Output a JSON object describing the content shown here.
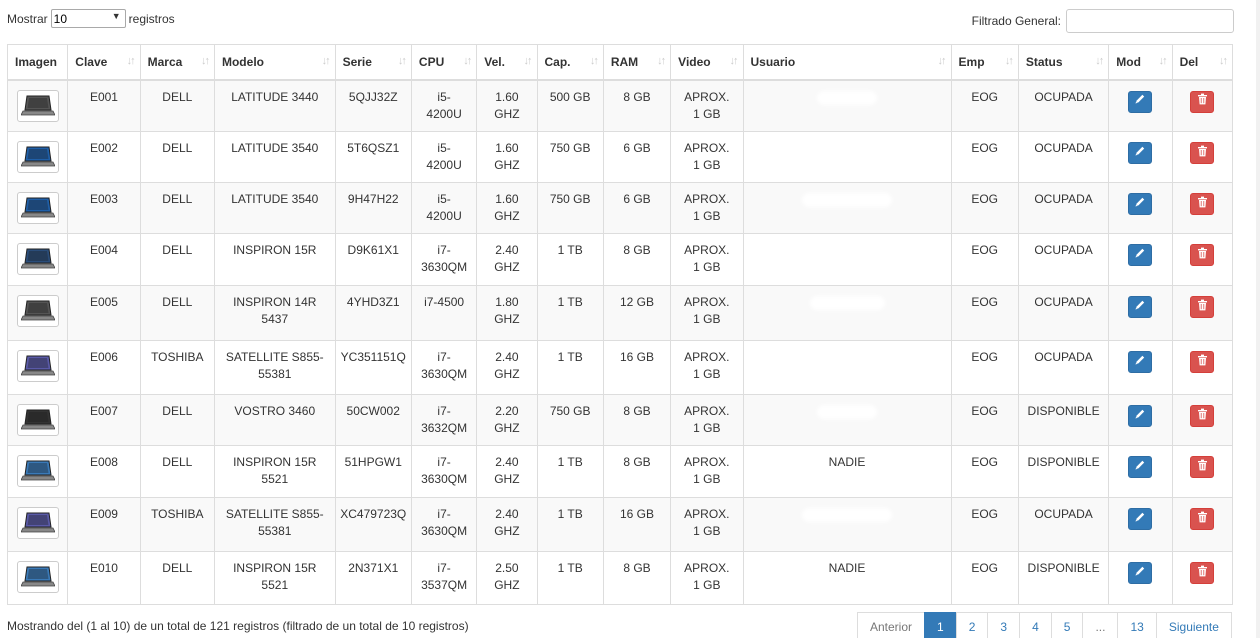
{
  "length_menu": {
    "prefix": "Mostrar",
    "value": "10",
    "suffix": "registros"
  },
  "filter": {
    "label": "Filtrado General:",
    "value": ""
  },
  "columns": [
    "Imagen",
    "Clave",
    "Marca",
    "Modelo",
    "Serie",
    "CPU",
    "Vel.",
    "Cap.",
    "RAM",
    "Video",
    "Usuario",
    "Emp",
    "Status",
    "Mod",
    "Del"
  ],
  "rows": [
    {
      "clave": "E001",
      "marca": "DELL",
      "modelo": "LATITUDE 3440",
      "serie": "5QJJ32Z",
      "cpu": "i5-\n4200U",
      "vel": "1.60\nGHZ",
      "cap": "500 GB",
      "ram": "8 GB",
      "video": "APROX.\n1 GB",
      "usuario": "",
      "emp": "EOG",
      "status": "OCUPADA",
      "laptop_color": "#555555"
    },
    {
      "clave": "E002",
      "marca": "DELL",
      "modelo": "LATITUDE 3540",
      "serie": "5T6QSZ1",
      "cpu": "i5-\n4200U",
      "vel": "1.60\nGHZ",
      "cap": "750 GB",
      "ram": "6 GB",
      "video": "APROX.\n1 GB",
      "usuario": "",
      "emp": "EOG",
      "status": "OCUPADA",
      "laptop_color": "#1f5fa8"
    },
    {
      "clave": "E003",
      "marca": "DELL",
      "modelo": "LATITUDE 3540",
      "serie": "9H47H22",
      "cpu": "i5-\n4200U",
      "vel": "1.60\nGHZ",
      "cap": "750 GB",
      "ram": "6 GB",
      "video": "APROX.\n1 GB",
      "usuario": "",
      "emp": "EOG",
      "status": "OCUPADA",
      "laptop_color": "#1f5fa8"
    },
    {
      "clave": "E004",
      "marca": "DELL",
      "modelo": "INSPIRON 15R",
      "serie": "D9K61X1",
      "cpu": "i7-\n3630QM",
      "vel": "2.40\nGHZ",
      "cap": "1 TB",
      "ram": "8 GB",
      "video": "APROX.\n1 GB",
      "usuario": "",
      "emp": "EOG",
      "status": "OCUPADA",
      "laptop_color": "#2a4d7a"
    },
    {
      "clave": "E005",
      "marca": "DELL",
      "modelo": "INSPIRON 14R\n5437",
      "serie": "4YHD3Z1",
      "cpu": "i7-4500",
      "vel": "1.80\nGHZ",
      "cap": "1 TB",
      "ram": "12 GB",
      "video": "APROX.\n1 GB",
      "usuario": "",
      "emp": "EOG",
      "status": "OCUPADA",
      "laptop_color": "#555555"
    },
    {
      "clave": "E006",
      "marca": "TOSHIBA",
      "modelo": "SATELLITE S855-\n55381",
      "serie": "YC351151Q",
      "cpu": "i7-\n3630QM",
      "vel": "2.40\nGHZ",
      "cap": "1 TB",
      "ram": "16 GB",
      "video": "APROX.\n1 GB",
      "usuario": "",
      "emp": "EOG",
      "status": "OCUPADA",
      "laptop_color": "#5a5aa8"
    },
    {
      "clave": "E007",
      "marca": "DELL",
      "modelo": "VOSTRO 3460",
      "serie": "50CW002",
      "cpu": "i7-\n3632QM",
      "vel": "2.20\nGHZ",
      "cap": "750 GB",
      "ram": "8 GB",
      "video": "APROX.\n1 GB",
      "usuario": "",
      "emp": "EOG",
      "status": "DISPONIBLE",
      "laptop_color": "#333333"
    },
    {
      "clave": "E008",
      "marca": "DELL",
      "modelo": "INSPIRON 15R\n5521",
      "serie": "51HPGW1",
      "cpu": "i7-\n3630QM",
      "vel": "2.40\nGHZ",
      "cap": "1 TB",
      "ram": "8 GB",
      "video": "APROX.\n1 GB",
      "usuario": "NADIE",
      "emp": "EOG",
      "status": "DISPONIBLE",
      "laptop_color": "#3a7ab8"
    },
    {
      "clave": "E009",
      "marca": "TOSHIBA",
      "modelo": "SATELLITE S855-\n55381",
      "serie": "XC479723Q",
      "cpu": "i7-\n3630QM",
      "vel": "2.40\nGHZ",
      "cap": "1 TB",
      "ram": "16 GB",
      "video": "APROX.\n1 GB",
      "usuario": "",
      "emp": "EOG",
      "status": "OCUPADA",
      "laptop_color": "#5a5aa8"
    },
    {
      "clave": "E010",
      "marca": "DELL",
      "modelo": "INSPIRON 15R\n5521",
      "serie": "2N371X1",
      "cpu": "i7-\n3537QM",
      "vel": "2.50\nGHZ",
      "cap": "1 TB",
      "ram": "8 GB",
      "video": "APROX.\n1 GB",
      "usuario": "NADIE",
      "emp": "EOG",
      "status": "DISPONIBLE",
      "laptop_color": "#3a7ab8"
    }
  ],
  "info_text": "Mostrando del (1 al 10) de un total de 121 registros (filtrado de un total de 10 registros)",
  "pagination": {
    "prev": "Anterior",
    "pages": [
      "1",
      "2",
      "3",
      "4",
      "5",
      "...",
      "13"
    ],
    "active": "1",
    "next": "Siguiente"
  },
  "colors": {
    "edit_button": "#337ab7",
    "delete_button": "#d9534f",
    "active_page": "#337ab7"
  }
}
